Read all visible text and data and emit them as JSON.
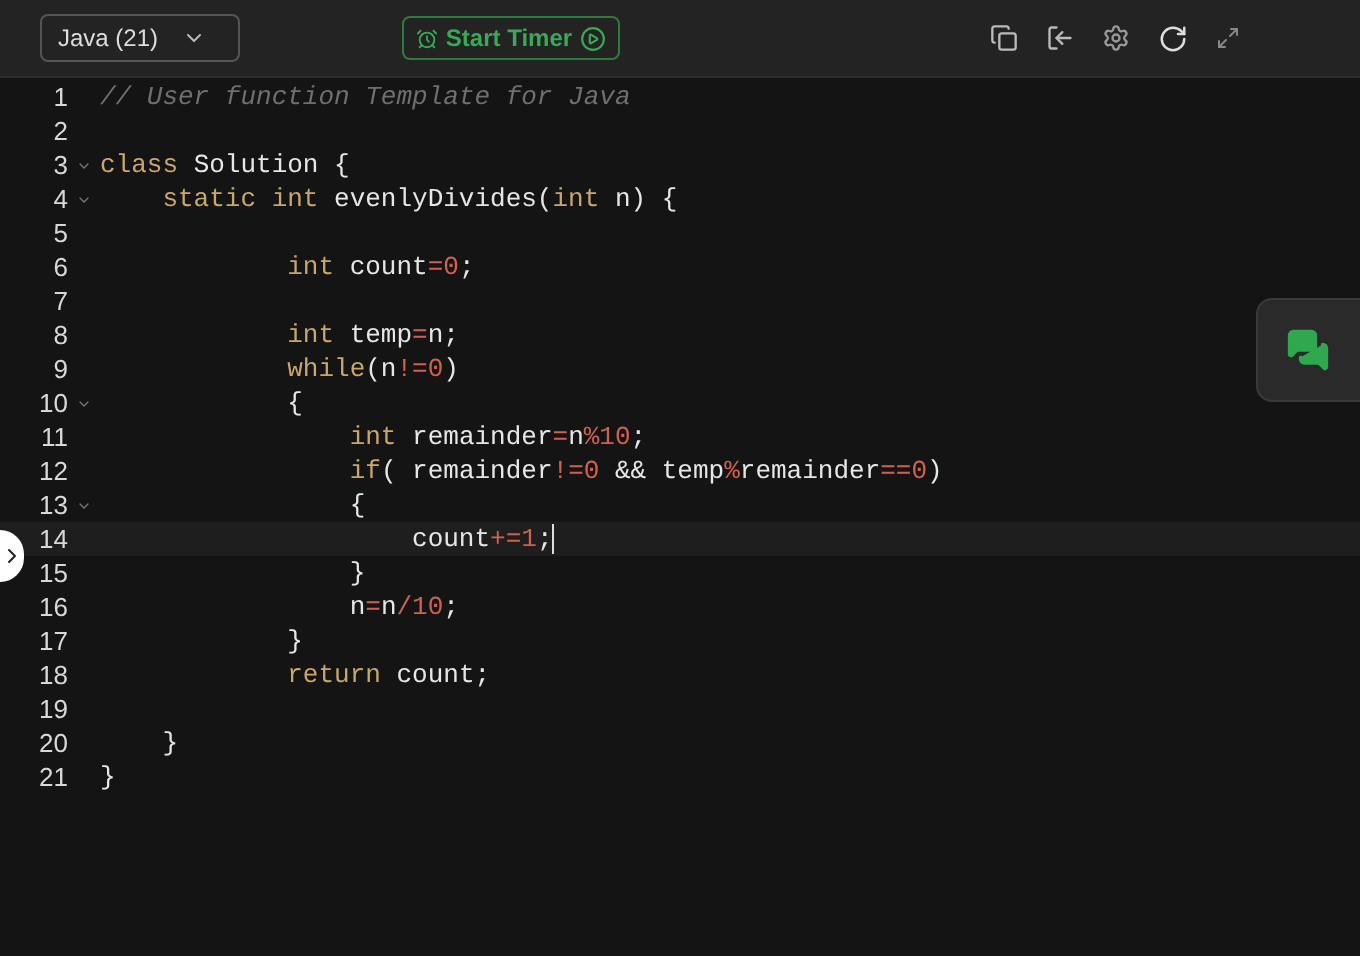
{
  "toolbar": {
    "language": "Java (21)",
    "timer_button": "Start Timer"
  },
  "editor": {
    "lines": [
      {
        "number": "1",
        "foldable": false,
        "active": false,
        "tokens": [
          {
            "kind": "comment",
            "text": "// User function Template for Java"
          }
        ]
      },
      {
        "number": "2",
        "foldable": false,
        "active": false
      },
      {
        "number": "3",
        "foldable": true,
        "active": false,
        "tokens": [
          {
            "kind": "keyword",
            "text": "class"
          },
          {
            "kind": "plain",
            "text": " Solution {"
          }
        ]
      },
      {
        "number": "4",
        "foldable": true,
        "active": false,
        "tokens": [
          {
            "kind": "keyword",
            "text": "    static int"
          },
          {
            "kind": "plain",
            "text": " evenlyDivides("
          },
          {
            "kind": "keyword",
            "text": "int"
          },
          {
            "kind": "plain",
            "text": " n) {"
          }
        ]
      },
      {
        "number": "5",
        "foldable": false,
        "active": false
      },
      {
        "number": "6",
        "foldable": false,
        "active": false,
        "tokens": [
          {
            "kind": "keyword",
            "text": "            int"
          },
          {
            "kind": "plain",
            "text": " count"
          },
          {
            "kind": "operator",
            "text": "=0"
          },
          {
            "kind": "plain",
            "text": ";"
          }
        ]
      },
      {
        "number": "7",
        "foldable": false,
        "active": false
      },
      {
        "number": "8",
        "foldable": false,
        "active": false,
        "tokens": [
          {
            "kind": "keyword",
            "text": "            int"
          },
          {
            "kind": "plain",
            "text": " temp"
          },
          {
            "kind": "operator",
            "text": "="
          },
          {
            "kind": "plain",
            "text": "n;"
          }
        ]
      },
      {
        "number": "9",
        "foldable": false,
        "active": false,
        "tokens": [
          {
            "kind": "keyword",
            "text": "            while"
          },
          {
            "kind": "plain",
            "text": "(n"
          },
          {
            "kind": "operator",
            "text": "!=0"
          },
          {
            "kind": "plain",
            "text": ")"
          }
        ]
      },
      {
        "number": "10",
        "foldable": true,
        "active": false,
        "tokens": [
          {
            "kind": "plain",
            "text": "            {"
          }
        ]
      },
      {
        "number": "11",
        "foldable": false,
        "active": false,
        "tokens": [
          {
            "kind": "keyword",
            "text": "                int"
          },
          {
            "kind": "plain",
            "text": " remainder"
          },
          {
            "kind": "operator",
            "text": "="
          },
          {
            "kind": "plain",
            "text": "n"
          },
          {
            "kind": "operator",
            "text": "%10"
          },
          {
            "kind": "plain",
            "text": ";"
          }
        ]
      },
      {
        "number": "12",
        "foldable": false,
        "active": false,
        "tokens": [
          {
            "kind": "keyword",
            "text": "                if"
          },
          {
            "kind": "plain",
            "text": "( remainder"
          },
          {
            "kind": "operator",
            "text": "!=0"
          },
          {
            "kind": "plain",
            "text": " && temp"
          },
          {
            "kind": "operator",
            "text": "%"
          },
          {
            "kind": "plain",
            "text": "remainder"
          },
          {
            "kind": "operator",
            "text": "==0"
          },
          {
            "kind": "plain",
            "text": ")"
          }
        ]
      },
      {
        "number": "13",
        "foldable": true,
        "active": false,
        "tokens": [
          {
            "kind": "plain",
            "text": "                {"
          }
        ]
      },
      {
        "number": "14",
        "foldable": false,
        "active": true,
        "tokens": [
          {
            "kind": "plain",
            "text": "                    count"
          },
          {
            "kind": "operator",
            "text": "+=1"
          },
          {
            "kind": "plain",
            "text": ";"
          }
        ]
      },
      {
        "number": "15",
        "foldable": false,
        "active": false,
        "tokens": [
          {
            "kind": "plain",
            "text": "                }"
          }
        ]
      },
      {
        "number": "16",
        "foldable": false,
        "active": false,
        "tokens": [
          {
            "kind": "plain",
            "text": "                n"
          },
          {
            "kind": "operator",
            "text": "="
          },
          {
            "kind": "plain",
            "text": "n"
          },
          {
            "kind": "operator",
            "text": "/10"
          },
          {
            "kind": "plain",
            "text": ";"
          }
        ]
      },
      {
        "number": "17",
        "foldable": false,
        "active": false,
        "tokens": [
          {
            "kind": "plain",
            "text": "            }"
          }
        ]
      },
      {
        "number": "18",
        "foldable": false,
        "active": false,
        "tokens": [
          {
            "kind": "keyword",
            "text": "            return"
          },
          {
            "kind": "plain",
            "text": " count;"
          }
        ]
      },
      {
        "number": "19",
        "foldable": false,
        "active": false
      },
      {
        "number": "20",
        "foldable": false,
        "active": false,
        "tokens": [
          {
            "kind": "plain",
            "text": "    }"
          }
        ]
      },
      {
        "number": "21",
        "foldable": false,
        "active": false,
        "tokens": [
          {
            "kind": "plain",
            "text": "}"
          }
        ]
      }
    ]
  }
}
